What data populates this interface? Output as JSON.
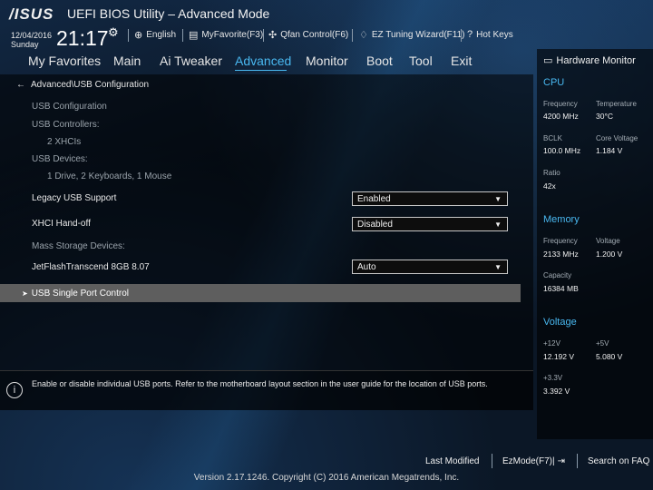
{
  "header": {
    "logo": "/ISUS",
    "title": "UEFI BIOS Utility – Advanced Mode",
    "date": "12/04/2016",
    "day": "Sunday",
    "time": "21:17",
    "tools": [
      {
        "label": "English",
        "icon": "globe-icon"
      },
      {
        "label": "MyFavorite(F3)",
        "icon": "favorite-icon"
      },
      {
        "label": "Qfan Control(F6)",
        "icon": "fan-icon"
      },
      {
        "label": "EZ Tuning Wizard(F11)",
        "icon": "bulb-icon"
      },
      {
        "label": "Hot Keys",
        "icon": "help-icon"
      }
    ]
  },
  "nav": {
    "tabs": [
      "My Favorites",
      "Main",
      "Ai Tweaker",
      "Advanced",
      "Monitor",
      "Boot",
      "Tool",
      "Exit"
    ],
    "active": "Advanced"
  },
  "main": {
    "breadcrumb": "Advanced\\USB Configuration",
    "info_rows": [
      "USB Configuration",
      "USB Controllers:",
      "2 XHCIs",
      "USB Devices:",
      "1 Drive, 2 Keyboards, 1 Mouse"
    ],
    "settings": {
      "legacy_label": "Legacy USB Support",
      "legacy_value": "Enabled",
      "xhci_label": "XHCI Hand-off",
      "xhci_value": "Disabled",
      "mass_storage_label": "Mass Storage Devices:",
      "jetflash_label": "JetFlashTranscend 8GB 8.07",
      "jetflash_value": "Auto"
    },
    "submenu": "USB Single Port Control"
  },
  "help": {
    "text": "Enable or disable individual USB ports. Refer to the motherboard layout section in the user guide for the location of USB ports."
  },
  "hw_monitor": {
    "title": "Hardware Monitor",
    "cpu": {
      "section": "CPU",
      "frequency_label": "Frequency",
      "frequency": "4200 MHz",
      "temperature_label": "Temperature",
      "temperature": "30°C",
      "bclk_label": "BCLK",
      "bclk": "100.0 MHz",
      "core_voltage_label": "Core Voltage",
      "core_voltage": "1.184 V",
      "ratio_label": "Ratio",
      "ratio": "42x"
    },
    "memory": {
      "section": "Memory",
      "frequency_label": "Frequency",
      "frequency": "2133 MHz",
      "voltage_label": "Voltage",
      "voltage": "1.200 V",
      "capacity_label": "Capacity",
      "capacity": "16384 MB"
    },
    "voltage": {
      "section": "Voltage",
      "v12_label": "+12V",
      "v12": "12.192 V",
      "v5_label": "+5V",
      "v5": "5.080 V",
      "v33_label": "+3.3V",
      "v33": "3.392 V"
    }
  },
  "footer": {
    "last_modified": "Last Modified",
    "ezmode": "EzMode(F7)|",
    "search": "Search on FAQ",
    "version": "Version 2.17.1246. Copyright (C) 2016 American Megatrends, Inc."
  },
  "colors": {
    "accent": "#49b8f0",
    "highlight_row": "#5e5e5e"
  }
}
